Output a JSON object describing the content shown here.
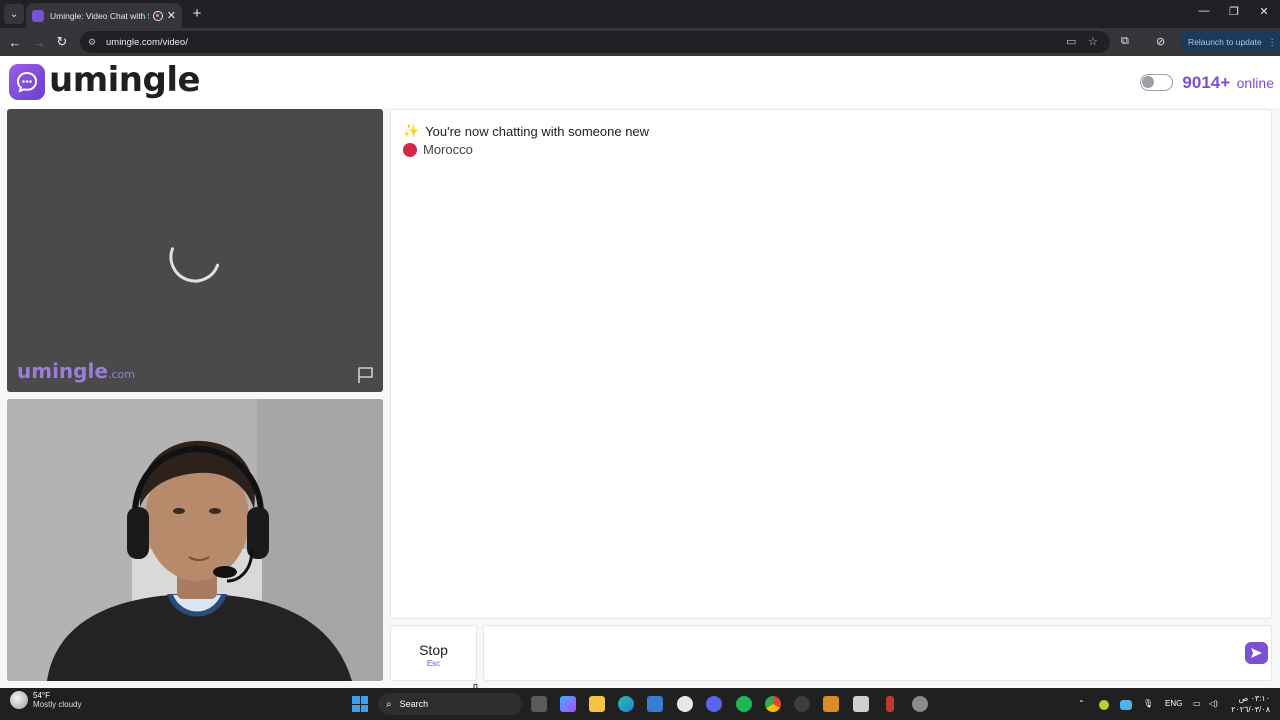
{
  "browser": {
    "tab_title": "Umingle: Video Chat with S",
    "url": "umingle.com/video/",
    "relaunch_label": "Relaunch to update"
  },
  "header": {
    "logo_text": "umingle",
    "online_count": "9014+",
    "online_label": "online"
  },
  "video": {
    "watermark_brand": "umingle",
    "watermark_tld": ".com"
  },
  "chat": {
    "status_message": "You're now chatting with someone new",
    "country": "Morocco",
    "country_color": "#d1284a",
    "input_value": ""
  },
  "controls": {
    "stop_label": "Stop",
    "stop_hint": "Esc"
  },
  "taskbar": {
    "weather_temp": "54°F",
    "weather_desc": "Mostly cloudy",
    "search_label": "Search",
    "language": "ENG",
    "clock_time": "٠٣:١٠ ص",
    "clock_date": "٢٠٢٦/٠٣/٠٨"
  },
  "colors": {
    "brand": "#7b4fd6",
    "video_bg": "#4a4a4a"
  },
  "icons": {
    "flag": "flag-icon",
    "send": "send-icon",
    "spinner": "loading-spinner-icon"
  }
}
